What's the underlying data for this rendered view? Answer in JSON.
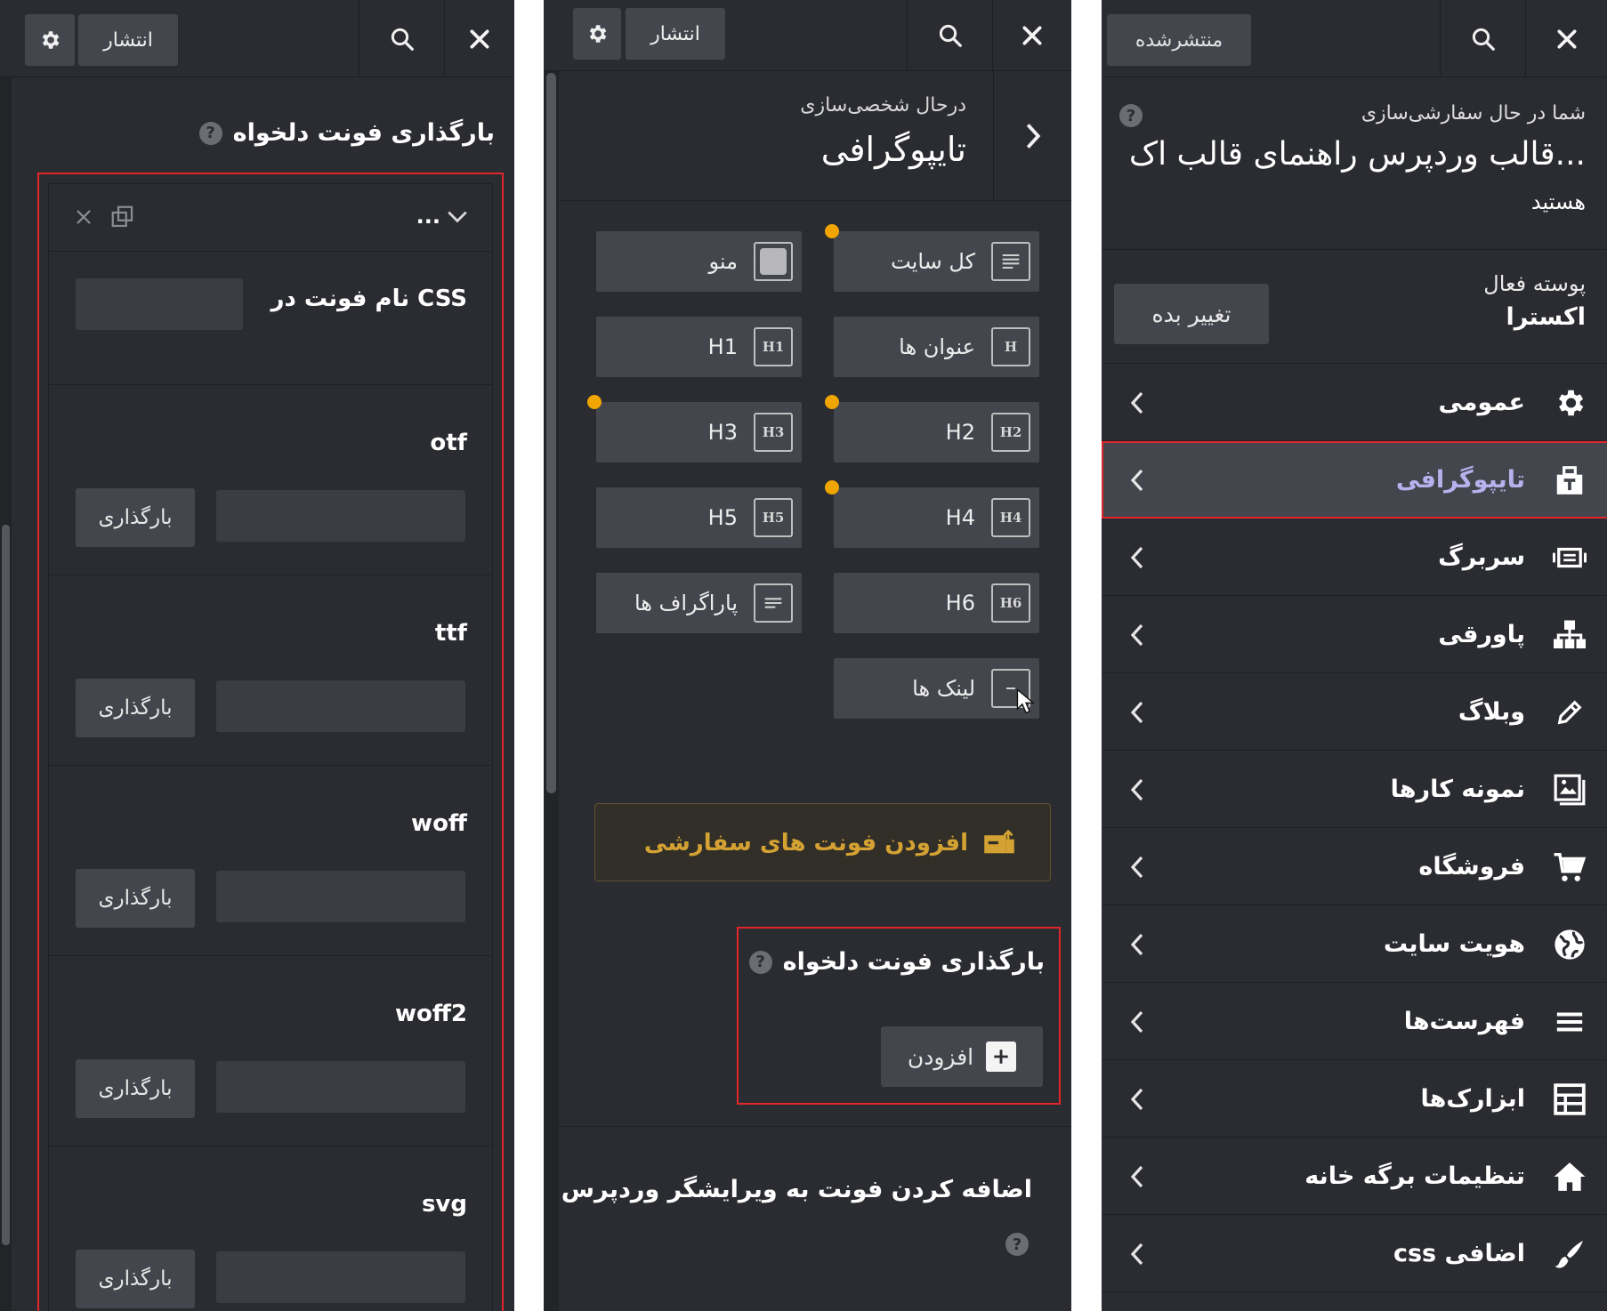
{
  "panel_a": {
    "publish_label": "انتشار",
    "section_title": "بارگذاری فونت دلخواه",
    "help_mark": "?",
    "repeater_title": "...",
    "css_name_label": "نام فونت در CSS",
    "css_name_value": "",
    "upload_button": "بارگذاری",
    "font_formats": [
      "otf",
      "ttf",
      "woff",
      "woff2",
      "svg"
    ]
  },
  "panel_b": {
    "publish_label": "انتشار",
    "breadcrumb": "درحال شخصی‌سازی",
    "title": "تایپوگرافی",
    "tiles": [
      {
        "label": "کل سایت",
        "icon": "lines",
        "badge": "",
        "dot": true
      },
      {
        "label": "منو",
        "icon": "square",
        "badge": "",
        "dot": false
      },
      {
        "label": "عنوان ها",
        "icon": "text",
        "badge": "H",
        "dot": false
      },
      {
        "label": "H1",
        "icon": "text",
        "badge": "H1",
        "dot": false
      },
      {
        "label": "H2",
        "icon": "text",
        "badge": "H2",
        "dot": true
      },
      {
        "label": "H3",
        "icon": "text",
        "badge": "H3",
        "dot": true
      },
      {
        "label": "H4",
        "icon": "text",
        "badge": "H4",
        "dot": true
      },
      {
        "label": "H5",
        "icon": "text",
        "badge": "H5",
        "dot": false
      },
      {
        "label": "H6",
        "icon": "text",
        "badge": "H6",
        "dot": false
      },
      {
        "label": "پاراگراف ها",
        "icon": "lines",
        "badge": "",
        "dot": false
      },
      {
        "label": "لینک ها",
        "icon": "minus",
        "badge": "",
        "dot": false
      }
    ],
    "custom_fonts_button": "افزودن فونت های سفارشی",
    "upload_section_title": "بارگذاری فونت دلخواه",
    "add_button": "افزودن",
    "editor_section_title": "اضافه کردن فونت به ویرایشگر وردپرس",
    "help_mark": "?"
  },
  "panel_c": {
    "status_button": "منتشرشده",
    "intro_small": "شما در حال سفارشی‌سازی",
    "intro_title": "قالب وردپرس راهنمای قالب اک...",
    "intro_tail": "هستید",
    "help_mark": "?",
    "active_theme_label": "پوسته فعال",
    "active_theme_name": "اکسترا",
    "change_button": "تغییر بده",
    "menu": [
      {
        "label": "عمومی",
        "icon": "gear-icon"
      },
      {
        "label": "تایپوگرافی",
        "icon": "typography-icon"
      },
      {
        "label": "سربرگ",
        "icon": "header-icon"
      },
      {
        "label": "پاورقی",
        "icon": "sitemap-icon"
      },
      {
        "label": "وبلاگ",
        "icon": "pencil-icon"
      },
      {
        "label": "نمونه کارها",
        "icon": "portfolio-icon"
      },
      {
        "label": "فروشگاه",
        "icon": "cart-icon"
      },
      {
        "label": "هویت سایت",
        "icon": "globe-icon"
      },
      {
        "label": "فهرست‌ها",
        "icon": "menu-icon"
      },
      {
        "label": "ابزارک‌ها",
        "icon": "widgets-icon"
      },
      {
        "label": "تنظیمات برگه خانه",
        "icon": "home-icon"
      },
      {
        "label": "css اضافی",
        "icon": "brush-icon"
      }
    ]
  },
  "colors": {
    "panel_bg": "#2b2c31",
    "field_bg": "#3b3d43",
    "button_bg": "#44464d",
    "highlight_red": "#e0262b",
    "accent_orange": "#f0a500",
    "active_purple": "#b7b2ee",
    "custom_fonts_gold": "#d4a233"
  }
}
